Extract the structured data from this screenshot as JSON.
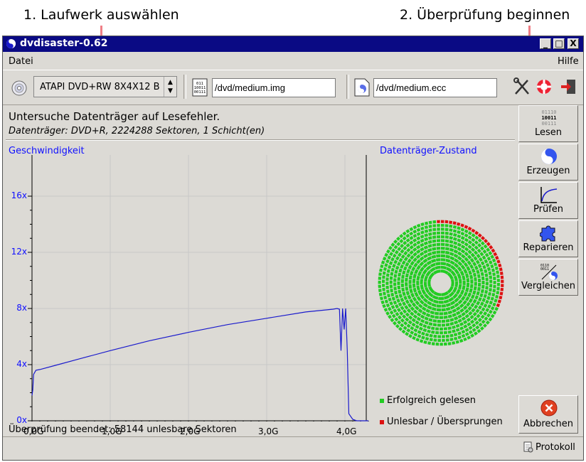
{
  "annotations": {
    "step1": "1. Laufwerk auswählen",
    "step2": "2. Überprüfung beginnen"
  },
  "window": {
    "title": "dvdisaster-0.62",
    "controls": [
      "_",
      "□",
      "X"
    ]
  },
  "menubar": {
    "file": "Datei",
    "help": "Hilfe"
  },
  "toolbar": {
    "drive_select": "ATAPI DVD+RW 8X4X12 B",
    "image_path": "/dvd/medium.img",
    "ecc_path": "/dvd/medium.ecc",
    "icons": [
      "cd-drive-icon",
      "image-file-icon",
      "ecc-file-icon",
      "preferences-icon",
      "help-icon",
      "quit-icon"
    ]
  },
  "main": {
    "message": "Untersuche Datenträger auf Lesefehler.",
    "medium_info": "Datenträger: DVD+R, 2224288 Sektoren, 1 Schicht(en)",
    "speed_title": "Geschwindigkeit",
    "disc_title": "Datenträger-Zustand",
    "legend_good": "Erfolgreich gelesen",
    "legend_bad": "Unlesbar / Übersprungen",
    "status": "Überprüfung beendet: 58144 unlesbare Sektoren",
    "colors": {
      "good": "#22cc22",
      "bad": "#dd1111",
      "curve": "#1a1acc"
    }
  },
  "chart_data": {
    "type": "line",
    "title": "Geschwindigkeit",
    "x_tick_labels": [
      "0,0G",
      "1,0G",
      "2,0G",
      "3,0G",
      "4,0G"
    ],
    "y_tick_labels": [
      "0x",
      "4x",
      "8x",
      "12x",
      "16x"
    ],
    "xlim": [
      0,
      4.3
    ],
    "ylim": [
      0,
      16.8
    ],
    "grid": true,
    "series": [
      {
        "x": [
          0.0,
          0.01,
          0.02,
          0.05,
          0.1,
          0.3,
          0.6,
          1.0,
          1.5,
          2.0,
          2.5,
          3.0,
          3.5,
          3.85,
          3.9,
          3.93,
          3.95,
          3.97,
          3.99,
          4.01,
          4.03,
          4.05,
          4.1,
          4.15,
          4.2,
          4.3
        ],
        "y": [
          1.8,
          2.2,
          3.3,
          3.6,
          3.65,
          3.95,
          4.4,
          5.0,
          5.7,
          6.3,
          6.85,
          7.3,
          7.75,
          7.95,
          8.0,
          7.95,
          5.0,
          8.0,
          6.5,
          8.0,
          5.0,
          0.5,
          0.1,
          0.0,
          0.0,
          0.0
        ]
      }
    ]
  },
  "disc": {
    "bad_arc_start_deg": -100,
    "bad_arc_end_deg": 20,
    "bad_fraction_outer_rings": 1
  },
  "sidebar": {
    "read": "Lesen",
    "create": "Erzeugen",
    "verify": "Prüfen",
    "repair": "Reparieren",
    "compare": "Vergleichen",
    "cancel": "Abbrechen"
  },
  "bottom": {
    "log": "Protokoll"
  }
}
